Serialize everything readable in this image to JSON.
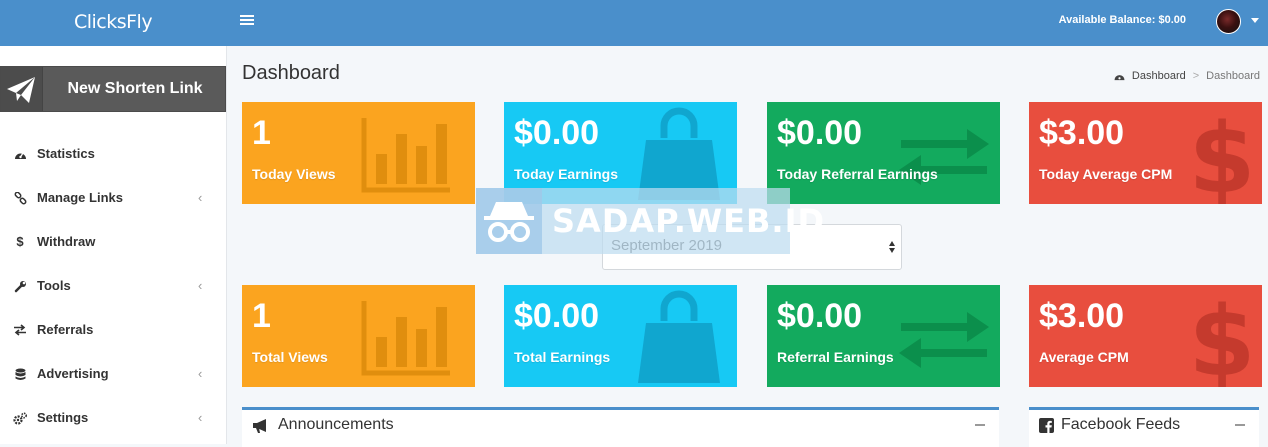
{
  "header": {
    "brand": "ClicksFly",
    "balance_label": "Available Balance: $0.00",
    "menu_icon": "hamburger-icon",
    "avatar_icon": "user-avatar"
  },
  "sidebar": {
    "new_link_label": "New Shorten Link",
    "new_link_icon": "paper-plane-icon",
    "items": [
      {
        "label": "Statistics",
        "icon": "dashboard-icon",
        "has_sub": false
      },
      {
        "label": "Manage Links",
        "icon": "link-icon",
        "has_sub": true
      },
      {
        "label": "Withdraw",
        "icon": "dollar-icon",
        "has_sub": false
      },
      {
        "label": "Tools",
        "icon": "wrench-icon",
        "has_sub": true
      },
      {
        "label": "Referrals",
        "icon": "exchange-icon",
        "has_sub": false
      },
      {
        "label": "Advertising",
        "icon": "database-icon",
        "has_sub": true
      },
      {
        "label": "Settings",
        "icon": "cogs-icon",
        "has_sub": true
      }
    ],
    "chevron": "‹"
  },
  "page": {
    "title": "Dashboard",
    "breadcrumb": [
      "Dashboard",
      ">",
      "Dashboard"
    ]
  },
  "stats_today": [
    {
      "value": "1",
      "label": "Today Views",
      "color": "#fba41f",
      "icon": "bar-chart-icon"
    },
    {
      "value": "$0.00",
      "label": "Today Earnings",
      "color": "#17c9f4",
      "icon": "shopping-bag-icon"
    },
    {
      "value": "$0.00",
      "label": "Today Referral Earnings",
      "color": "#13aa5e",
      "icon": "exchange-arrows-icon"
    },
    {
      "value": "$3.00",
      "label": "Today Average CPM",
      "color": "#e84e3e",
      "icon": "dollar-sign-icon"
    }
  ],
  "month_select": {
    "value": "September 2019"
  },
  "watermark": {
    "text": "SADAP.WEB.ID"
  },
  "stats_total": [
    {
      "value": "1",
      "label": "Total Views",
      "color": "#fba41f",
      "icon": "bar-chart-icon"
    },
    {
      "value": "$0.00",
      "label": "Total Earnings",
      "color": "#17c9f4",
      "icon": "shopping-bag-icon"
    },
    {
      "value": "$0.00",
      "label": "Referral Earnings",
      "color": "#13aa5e",
      "icon": "exchange-arrows-icon"
    },
    {
      "value": "$3.00",
      "label": "Average CPM",
      "color": "#e84e3e",
      "icon": "dollar-sign-icon"
    }
  ],
  "panels": {
    "announcements": "Announcements",
    "facebook": "Facebook Feeds"
  }
}
